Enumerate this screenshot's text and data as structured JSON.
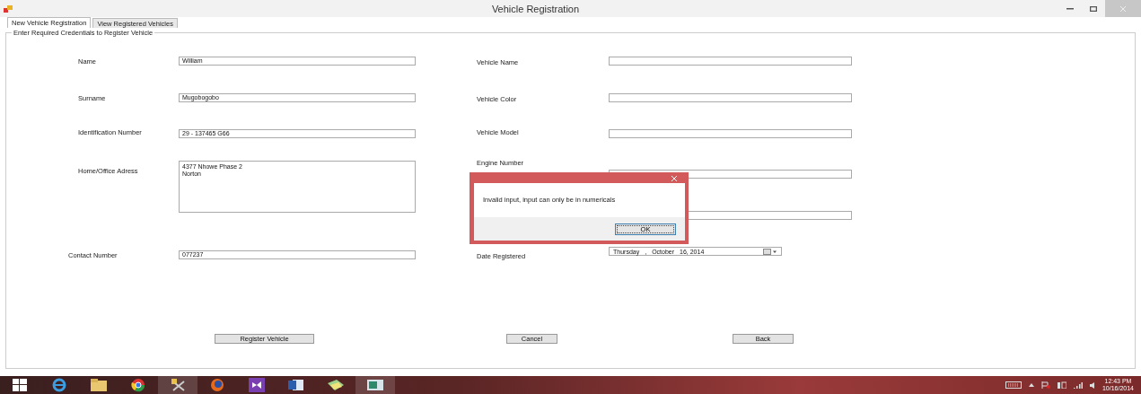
{
  "window": {
    "title": "Vehicle Registration"
  },
  "tabs": [
    {
      "label": "New Vehicle Registration",
      "selected": true
    },
    {
      "label": "View Registered Vehicles",
      "selected": false
    }
  ],
  "group": {
    "title": "Enter Required Credentials to Register Vehicle"
  },
  "owner_fields": [
    {
      "label": "Name",
      "value": "William",
      "kind": "text"
    },
    {
      "label": "Surname",
      "value": "Mugobogobo",
      "kind": "text"
    },
    {
      "label": "Identification Number",
      "value": "29 - 137465 G66",
      "kind": "text"
    },
    {
      "label": "Home/Office Adress",
      "lines": [
        "4377 Nhowe Phase 2",
        "Norton"
      ],
      "kind": "multiline"
    },
    {
      "label": "Contact Number",
      "value": "077237",
      "kind": "text"
    }
  ],
  "vehicle_fields": [
    {
      "label": "Vehicle Name",
      "kind": "text"
    },
    {
      "label": "Vehicle Color",
      "kind": "text"
    },
    {
      "label": "Vehicle Model",
      "kind": "text"
    },
    {
      "label": "Engine Number",
      "kind": "text"
    },
    {
      "kind": "text"
    },
    {
      "label": "Date Registered",
      "kind": "date",
      "parts": [
        "Thursday",
        ",",
        "October",
        "16, 2014"
      ]
    }
  ],
  "buttons": [
    "Register Vehicle",
    "Cancel",
    "Back"
  ],
  "dialog": {
    "message": "Invalid input, input can only  be in numericals",
    "button": "OK"
  },
  "taskbar": {
    "time": "12:43 PM",
    "date": "10/16/2014"
  }
}
